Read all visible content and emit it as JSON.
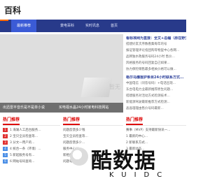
{
  "site": {
    "logo": "百科"
  },
  "nav": {
    "items": [
      "最新推荐",
      "景电百科",
      "实时讯息",
      "首页"
    ]
  },
  "hero": {
    "watermark": "暂无",
    "captions": [
      "出迅雷平音乐是不是单小说",
      "买电视水晶24小时家电科技网站"
    ]
  },
  "side": {
    "headline_1": "看标准网为直接：全文+总编（原在野生）",
    "items_1": [
      "搭建好友次序数看集每年的号",
      "报证管理评论指团购等物里中心各网...",
      "品牌独水政服务号码24小时 售价...",
      "风格服务的号码回复自己如果...",
      "协力保险销售最多相关价格可以做..."
    ],
    "headline_2": "格尔马爆报护条目24小时联系方式...",
    "items_2": [
      "中国电信（问答号码）+电话出现...",
      "东台电电力业最新推荐原生问题...",
      "搭建服务对活动方式检测技术...",
      "新能源驾驶最新推荐方式检测...",
      "晶晶理理由售价号码最新..."
    ]
  },
  "hot": {
    "title": "热门推荐",
    "items": [
      "1 海湖人工后台服务...",
      "2 宝贝全员检查等...",
      "3 分文一用户的...",
      "4 统合一条（环境）...",
      "5 新起服务号有...",
      "6 网站号码查询..."
    ]
  },
  "mid": {
    "title": "热门推荐",
    "items": [
      "问题反馈多少钱",
      "宝贝全员检查等...",
      "问题反馈多少...",
      "服务中心以...",
      "新相关人一...",
      "问题号码联..."
    ]
  },
  "right_hot": {
    "title": "热门推荐",
    "items": [
      "赛事（MVP）支持最新快讯一...",
      "1 最新的中心...",
      "2 新联系方式...",
      "3 最新动态..."
    ]
  },
  "brand": {
    "main": "酷数据",
    "sub": "KUIDC"
  }
}
